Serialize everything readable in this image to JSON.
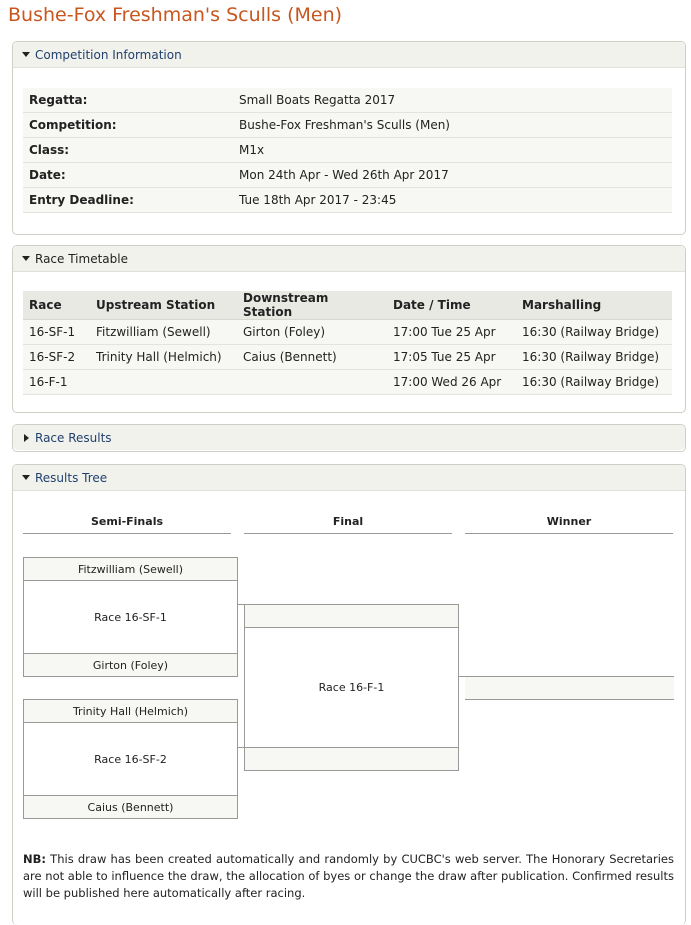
{
  "page_title": "Bushe-Fox Freshman's Sculls (Men)",
  "competition_info": {
    "heading": "Competition Information",
    "rows": [
      {
        "label": "Regatta:",
        "value": "Small Boats Regatta 2017"
      },
      {
        "label": "Competition:",
        "value": "Bushe-Fox Freshman's Sculls (Men)"
      },
      {
        "label": "Class:",
        "value": "M1x"
      },
      {
        "label": "Date:",
        "value": "Mon 24th Apr - Wed 26th Apr 2017"
      },
      {
        "label": "Entry Deadline:",
        "value": "Tue 18th Apr 2017 - 23:45"
      }
    ]
  },
  "race_timetable": {
    "heading": "Race Timetable",
    "columns": [
      "Race",
      "Upstream Station",
      "Downstream Station",
      "Date / Time",
      "Marshalling"
    ],
    "rows": [
      [
        "16-SF-1",
        "Fitzwilliam (Sewell)",
        "Girton (Foley)",
        "17:00 Tue 25 Apr",
        "16:30 (Railway Bridge)"
      ],
      [
        "16-SF-2",
        "Trinity Hall (Helmich)",
        "Caius (Bennett)",
        "17:05 Tue 25 Apr",
        "16:30 (Railway Bridge)"
      ],
      [
        "16-F-1",
        "",
        "",
        "17:00 Wed 26 Apr",
        "16:30 (Railway Bridge)"
      ]
    ]
  },
  "race_results": {
    "heading": "Race Results"
  },
  "results_tree": {
    "heading": "Results Tree",
    "columns": [
      "Semi-Finals",
      "Final",
      "Winner"
    ],
    "sf1": {
      "top": "Fitzwilliam (Sewell)",
      "race": "Race 16-SF-1",
      "bottom": "Girton (Foley)"
    },
    "sf2": {
      "top": "Trinity Hall (Helmich)",
      "race": "Race 16-SF-2",
      "bottom": "Caius (Bennett)"
    },
    "final": {
      "top": "",
      "race": "Race 16-F-1",
      "bottom": ""
    },
    "winner": "",
    "note_bold": "NB:",
    "note_text": " This draw has been created automatically and randomly by CUCBC's web server. The Honorary Secretaries are not able to influence the draw, the allocation of byes or change the draw after publication. Confirmed results will be published here automatically after racing."
  }
}
